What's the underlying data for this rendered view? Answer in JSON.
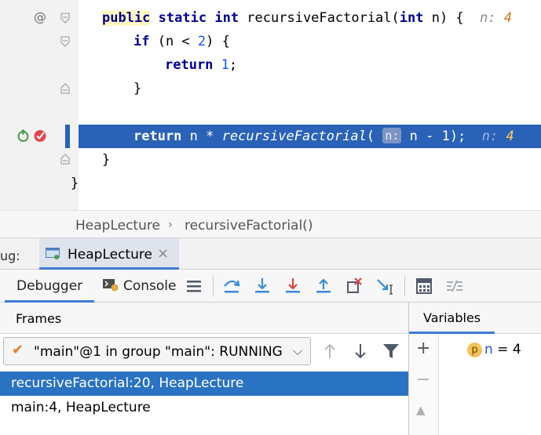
{
  "editor": {
    "gutter": {
      "annotation_mark": "@"
    },
    "lines": {
      "line1": {
        "kw1": "public",
        "kw2": "static",
        "kw3": "int",
        "name": " recursiveFactorial(",
        "kw4": "int",
        "rest": " n) {",
        "hint_name": "n:",
        "hint_value": "4"
      },
      "line2": {
        "kw": "if",
        "pre": " (n < ",
        "num": "2",
        "post": ") {"
      },
      "line3": {
        "kw": "return",
        "num": "1",
        "post": ";"
      },
      "line4": {
        "text": "}"
      },
      "line6": {
        "kw": "return",
        "mid": " n * ",
        "call": "recursiveFactorial",
        "open": "(",
        "param_chip": "n:",
        "args": " n - 1);",
        "hint_name": "n:",
        "hint_value": "4"
      },
      "line7": {
        "text": "}"
      },
      "line8": {
        "text": "}"
      }
    }
  },
  "breadcrumb": {
    "items": [
      "HeapLecture",
      "recursiveFactorial()"
    ],
    "separator": "›"
  },
  "debug": {
    "label": "ug:",
    "session_tab": {
      "name": "HeapLecture",
      "close": "×"
    },
    "tabs": {
      "debugger": "Debugger",
      "console": "Console"
    },
    "toolbar_icons": [
      "restore-layout-icon",
      "show-execution-point-icon",
      "step-over-icon",
      "step-into-icon",
      "force-step-into-icon",
      "step-out-icon",
      "drop-frame-icon",
      "run-to-cursor-icon",
      "evaluate-expression-icon",
      "trace-icon"
    ]
  },
  "frames": {
    "title": "Frames",
    "thread": {
      "check": "✔",
      "text": "\"main\"@1 in group \"main\": RUNNING",
      "chevron": "⌵"
    },
    "rows": [
      "recursiveFactorial:20, HeapLecture",
      "main:4, HeapLecture"
    ],
    "selected_index": 0
  },
  "variables": {
    "title": "Variables",
    "buttons": {
      "add": "+",
      "remove": "−",
      "up": "▲"
    },
    "items": [
      {
        "badge": "p",
        "name": "n",
        "eq": " = ",
        "value": "4"
      }
    ]
  },
  "colors": {
    "execution_line": "#2a62b7",
    "selected_frame": "#2a72c2",
    "keyword": "#00008b",
    "number": "#1750eb",
    "hint_value": "#c57e1d",
    "method_highlight": "#fff8c4"
  }
}
